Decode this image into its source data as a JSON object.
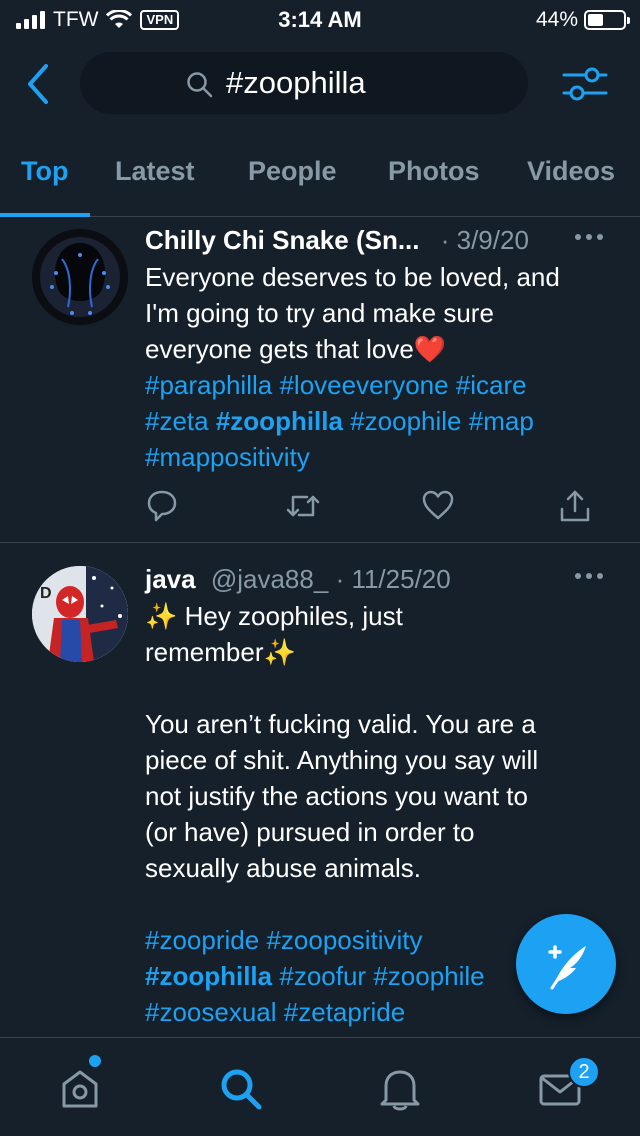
{
  "status_bar": {
    "carrier": "TFW",
    "vpn": "VPN",
    "time": "3:14 AM",
    "battery": "44%",
    "battery_level": 0.44
  },
  "search": {
    "query": "#zoophilla"
  },
  "tabs": [
    {
      "label": "Top",
      "active": true
    },
    {
      "label": "Latest",
      "active": false
    },
    {
      "label": "People",
      "active": false
    },
    {
      "label": "Photos",
      "active": false
    },
    {
      "label": "Videos",
      "active": false
    }
  ],
  "tweets": [
    {
      "name": "Chilly Chi Snake (Sn...",
      "handle": "",
      "date": "· 3/9/20",
      "text_lines": [
        "Everyone deserves to be loved, and",
        "I'm going to try and make sure",
        "everyone gets that love"
      ],
      "emoji_end": "❤️",
      "hashtag_lines": [
        [
          "#paraphilla",
          "#loveeveryone",
          "#icare"
        ],
        [
          "#zeta",
          "#zoophilla",
          "#zoophile",
          "#map"
        ],
        [
          "#mappositivity"
        ]
      ]
    },
    {
      "name": "java",
      "handle": "@java88_",
      "date": "· 11/25/20",
      "line1": "✨ Hey zoophiles, just",
      "line2": "remember✨",
      "body_lines": [
        "You aren’t fucking valid. You are a",
        "piece of shit. Anything you say will",
        "not justify the actions you want to",
        "(or have) pursued in order to",
        "sexually abuse animals."
      ],
      "hashtag_lines": [
        [
          "#zoopride",
          "#zoopositivity"
        ],
        [
          "#zoophilla",
          "#zoofur",
          "#zoophile"
        ],
        [
          "#zoosexual",
          "#zetapride"
        ]
      ]
    }
  ],
  "bottom_nav": {
    "items": [
      "home-icon",
      "search-icon",
      "bell-icon",
      "mail-icon"
    ],
    "mail_badge": "2"
  },
  "colors": {
    "background": "#15202b",
    "accent": "#1da1f2",
    "muted": "#8899a6"
  }
}
